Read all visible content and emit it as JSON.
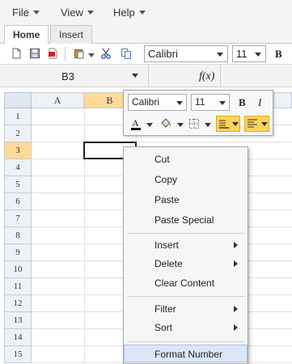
{
  "menubar": {
    "items": [
      {
        "label": "File"
      },
      {
        "label": "View"
      },
      {
        "label": "Help"
      }
    ]
  },
  "tabs": [
    {
      "label": "Home",
      "active": true
    },
    {
      "label": "Insert",
      "active": false
    }
  ],
  "toolbar": {
    "font_name": "Calibri",
    "font_size": "11",
    "bold_label": "B"
  },
  "name_box": {
    "value": "B3"
  },
  "formula_bar": {
    "fx_label": "f(x)",
    "value": ""
  },
  "grid": {
    "columns": [
      "A",
      "B",
      "C"
    ],
    "rows": [
      "1",
      "2",
      "3",
      "4",
      "5",
      "6",
      "7",
      "8",
      "9",
      "10",
      "11",
      "12",
      "13",
      "14",
      "15"
    ],
    "selected": {
      "column": "B",
      "row": "3"
    }
  },
  "mini_toolbar": {
    "font_name": "Calibri",
    "font_size": "11",
    "bold_label": "B",
    "italic_label": "I",
    "font_color": "#000000",
    "fill_color": "#ffd35a"
  },
  "context_menu": {
    "items": [
      {
        "label": "Cut"
      },
      {
        "label": "Copy"
      },
      {
        "label": "Paste"
      },
      {
        "label": "Paste Special"
      },
      {
        "label": "Insert"
      },
      {
        "label": "Delete"
      },
      {
        "label": "Clear Content"
      },
      {
        "label": "Filter"
      },
      {
        "label": "Sort"
      },
      {
        "label": "Format Number"
      }
    ]
  },
  "colors": {
    "selection_header": "#ffd998",
    "accent_border": "#a8c1e2"
  }
}
